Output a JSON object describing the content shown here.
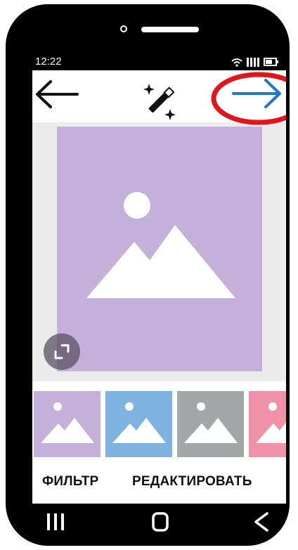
{
  "status_bar": {
    "time": "12:22",
    "icons": [
      "wifi-icon",
      "signal-icon",
      "battery-icon"
    ]
  },
  "toolbar": {
    "back_icon": "arrow-left-icon",
    "magic_icon": "magic-wand-icon",
    "next_icon": "arrow-right-icon",
    "next_color": "#1f78c8",
    "highlight_color": "#e0161c"
  },
  "main_image": {
    "placeholder_icon": "image-placeholder-icon",
    "background_color": "#c4b0d9",
    "expand_icon": "expand-icon"
  },
  "thumbnails": [
    {
      "color": "#c4b0d9"
    },
    {
      "color": "#7fb2e0"
    },
    {
      "color": "#a4a7a8"
    },
    {
      "color": "#ef92a8"
    }
  ],
  "tabs": {
    "filter_label": "ФИЛЬТР",
    "edit_label": "РЕДАКТИРОВАТЬ"
  },
  "nav_bar": {
    "recents_icon": "recents-icon",
    "home_icon": "home-icon",
    "back_icon": "back-chevron-icon"
  }
}
